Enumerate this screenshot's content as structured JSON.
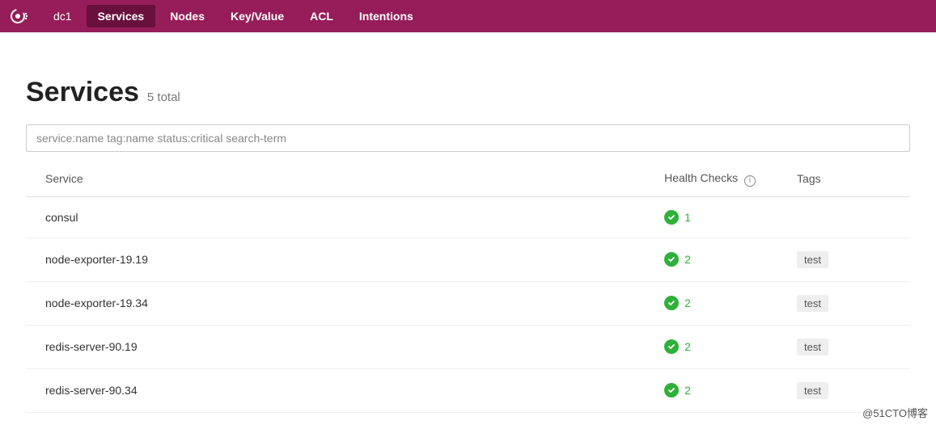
{
  "nav": {
    "datacenter": "dc1",
    "items": [
      "Services",
      "Nodes",
      "Key/Value",
      "ACL",
      "Intentions"
    ],
    "active": "Services"
  },
  "header": {
    "title": "Services",
    "count_label": "5 total"
  },
  "search": {
    "placeholder": "service:name tag:name status:critical search-term",
    "value": ""
  },
  "table": {
    "columns": {
      "service": "Service",
      "health": "Health Checks",
      "tags": "Tags"
    },
    "rows": [
      {
        "name": "consul",
        "health_count": "1",
        "tags": []
      },
      {
        "name": "node-exporter-19.19",
        "health_count": "2",
        "tags": [
          "test"
        ]
      },
      {
        "name": "node-exporter-19.34",
        "health_count": "2",
        "tags": [
          "test"
        ]
      },
      {
        "name": "redis-server-90.19",
        "health_count": "2",
        "tags": [
          "test"
        ]
      },
      {
        "name": "redis-server-90.34",
        "health_count": "2",
        "tags": [
          "test"
        ]
      }
    ]
  },
  "watermark": "@51CTO博客"
}
